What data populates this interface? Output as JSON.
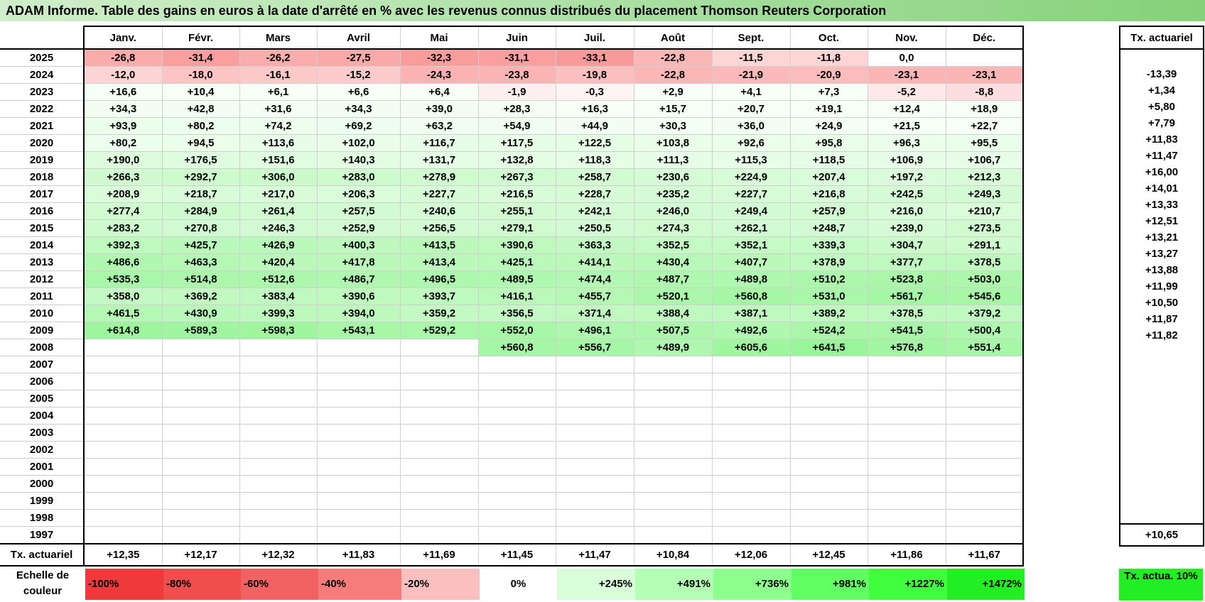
{
  "title": "ADAM Informe. Table des gains en euros à la date d'arrêté en % avec les revenus connus distribués du placement Thomson Reuters Corporation",
  "months": [
    "Janv.",
    "Févr.",
    "Mars",
    "Avril",
    "Mai",
    "Juin",
    "Juil.",
    "Août",
    "Sept.",
    "Oct.",
    "Nov.",
    "Déc."
  ],
  "rate_header": "Tx. actuariel",
  "footer_label": "Tx. actuariel",
  "rows": [
    {
      "year": "2025",
      "cells": [
        "-26,8",
        "-31,4",
        "-26,2",
        "-27,5",
        "-32,3",
        "-31,1",
        "-33,1",
        "-22,8",
        "-11,5",
        "-11,8",
        "0,0",
        ""
      ],
      "rate": ""
    },
    {
      "year": "2024",
      "cells": [
        "-12,0",
        "-18,0",
        "-16,1",
        "-15,2",
        "-24,3",
        "-23,8",
        "-19,8",
        "-22,8",
        "-21,9",
        "-20,9",
        "-23,1",
        "-23,1"
      ],
      "rate": "-13,39"
    },
    {
      "year": "2023",
      "cells": [
        "+16,6",
        "+10,4",
        "+6,1",
        "+6,6",
        "+6,4",
        "-1,9",
        "-0,3",
        "+2,9",
        "+4,1",
        "+7,3",
        "-5,2",
        "-8,8"
      ],
      "rate": "+1,34"
    },
    {
      "year": "2022",
      "cells": [
        "+34,3",
        "+42,8",
        "+31,6",
        "+34,3",
        "+39,0",
        "+28,3",
        "+16,3",
        "+15,7",
        "+20,7",
        "+19,1",
        "+12,4",
        "+18,9"
      ],
      "rate": "+5,80"
    },
    {
      "year": "2021",
      "cells": [
        "+93,9",
        "+80,2",
        "+74,2",
        "+69,2",
        "+63,2",
        "+54,9",
        "+44,9",
        "+30,3",
        "+36,0",
        "+24,9",
        "+21,5",
        "+22,7"
      ],
      "rate": "+7,79"
    },
    {
      "year": "2020",
      "cells": [
        "+80,2",
        "+94,5",
        "+113,6",
        "+102,0",
        "+116,7",
        "+117,5",
        "+122,5",
        "+103,8",
        "+92,6",
        "+95,8",
        "+96,3",
        "+95,5"
      ],
      "rate": "+11,83"
    },
    {
      "year": "2019",
      "cells": [
        "+190,0",
        "+176,5",
        "+151,6",
        "+140,3",
        "+131,7",
        "+132,8",
        "+118,3",
        "+111,3",
        "+115,3",
        "+118,5",
        "+106,9",
        "+106,7"
      ],
      "rate": "+11,47"
    },
    {
      "year": "2018",
      "cells": [
        "+266,3",
        "+292,7",
        "+306,0",
        "+283,0",
        "+278,9",
        "+267,3",
        "+258,7",
        "+230,6",
        "+224,9",
        "+207,4",
        "+197,2",
        "+212,3"
      ],
      "rate": "+16,00"
    },
    {
      "year": "2017",
      "cells": [
        "+208,9",
        "+218,7",
        "+217,0",
        "+206,3",
        "+227,7",
        "+216,5",
        "+228,7",
        "+235,2",
        "+227,7",
        "+216,8",
        "+242,5",
        "+249,3"
      ],
      "rate": "+14,01"
    },
    {
      "year": "2016",
      "cells": [
        "+277,4",
        "+284,9",
        "+261,4",
        "+257,5",
        "+240,6",
        "+255,1",
        "+242,1",
        "+246,0",
        "+249,4",
        "+257,9",
        "+216,0",
        "+210,7"
      ],
      "rate": "+13,33"
    },
    {
      "year": "2015",
      "cells": [
        "+283,2",
        "+270,8",
        "+246,3",
        "+252,9",
        "+256,5",
        "+279,1",
        "+250,5",
        "+274,3",
        "+262,1",
        "+248,7",
        "+239,0",
        "+273,5"
      ],
      "rate": "+12,51"
    },
    {
      "year": "2014",
      "cells": [
        "+392,3",
        "+425,7",
        "+426,9",
        "+400,3",
        "+413,5",
        "+390,6",
        "+363,3",
        "+352,5",
        "+352,1",
        "+339,3",
        "+304,7",
        "+291,1"
      ],
      "rate": "+13,21"
    },
    {
      "year": "2013",
      "cells": [
        "+486,6",
        "+463,3",
        "+420,4",
        "+417,8",
        "+413,4",
        "+425,1",
        "+414,1",
        "+430,4",
        "+407,7",
        "+378,9",
        "+377,7",
        "+378,5"
      ],
      "rate": "+13,27"
    },
    {
      "year": "2012",
      "cells": [
        "+535,3",
        "+514,8",
        "+512,6",
        "+486,7",
        "+496,5",
        "+489,5",
        "+474,4",
        "+487,7",
        "+489,8",
        "+510,2",
        "+523,8",
        "+503,0"
      ],
      "rate": "+13,88"
    },
    {
      "year": "2011",
      "cells": [
        "+358,0",
        "+369,2",
        "+383,4",
        "+390,6",
        "+393,7",
        "+416,1",
        "+455,7",
        "+520,1",
        "+560,8",
        "+531,0",
        "+561,7",
        "+545,6"
      ],
      "rate": "+11,99"
    },
    {
      "year": "2010",
      "cells": [
        "+461,5",
        "+430,9",
        "+399,3",
        "+394,0",
        "+359,2",
        "+356,5",
        "+371,4",
        "+388,4",
        "+387,1",
        "+389,2",
        "+378,5",
        "+379,2"
      ],
      "rate": "+10,50"
    },
    {
      "year": "2009",
      "cells": [
        "+614,8",
        "+589,3",
        "+598,3",
        "+543,1",
        "+529,2",
        "+552,0",
        "+496,1",
        "+507,5",
        "+492,6",
        "+524,2",
        "+541,5",
        "+500,4"
      ],
      "rate": "+11,87"
    },
    {
      "year": "2008",
      "cells": [
        "",
        "",
        "",
        "",
        "",
        "+560,8",
        "+556,7",
        "+489,9",
        "+605,6",
        "+641,5",
        "+576,8",
        "+551,4"
      ],
      "rate": "+11,82"
    },
    {
      "year": "2007",
      "cells": [
        "",
        "",
        "",
        "",
        "",
        "",
        "",
        "",
        "",
        "",
        "",
        ""
      ],
      "rate": ""
    },
    {
      "year": "2006",
      "cells": [
        "",
        "",
        "",
        "",
        "",
        "",
        "",
        "",
        "",
        "",
        "",
        ""
      ],
      "rate": ""
    },
    {
      "year": "2005",
      "cells": [
        "",
        "",
        "",
        "",
        "",
        "",
        "",
        "",
        "",
        "",
        "",
        ""
      ],
      "rate": ""
    },
    {
      "year": "2004",
      "cells": [
        "",
        "",
        "",
        "",
        "",
        "",
        "",
        "",
        "",
        "",
        "",
        ""
      ],
      "rate": ""
    },
    {
      "year": "2003",
      "cells": [
        "",
        "",
        "",
        "",
        "",
        "",
        "",
        "",
        "",
        "",
        "",
        ""
      ],
      "rate": ""
    },
    {
      "year": "2002",
      "cells": [
        "",
        "",
        "",
        "",
        "",
        "",
        "",
        "",
        "",
        "",
        "",
        ""
      ],
      "rate": ""
    },
    {
      "year": "2001",
      "cells": [
        "",
        "",
        "",
        "",
        "",
        "",
        "",
        "",
        "",
        "",
        "",
        ""
      ],
      "rate": ""
    },
    {
      "year": "2000",
      "cells": [
        "",
        "",
        "",
        "",
        "",
        "",
        "",
        "",
        "",
        "",
        "",
        ""
      ],
      "rate": ""
    },
    {
      "year": "1999",
      "cells": [
        "",
        "",
        "",
        "",
        "",
        "",
        "",
        "",
        "",
        "",
        "",
        ""
      ],
      "rate": ""
    },
    {
      "year": "1998",
      "cells": [
        "",
        "",
        "",
        "",
        "",
        "",
        "",
        "",
        "",
        "",
        "",
        ""
      ],
      "rate": ""
    },
    {
      "year": "1997",
      "cells": [
        "",
        "",
        "",
        "",
        "",
        "",
        "",
        "",
        "",
        "",
        "",
        ""
      ],
      "rate": ""
    }
  ],
  "footer": {
    "cells": [
      "+12,35",
      "+12,17",
      "+12,32",
      "+11,83",
      "+11,69",
      "+11,45",
      "+11,47",
      "+10,84",
      "+12,06",
      "+12,45",
      "+11,86",
      "+11,67"
    ],
    "rate": "+10,65"
  },
  "scale": {
    "label": "Echelle de couleur",
    "steps": [
      "-100%",
      "-80%",
      "-60%",
      "-40%",
      "-20%",
      "0%",
      "+245%",
      "+491%",
      "+736%",
      "+981%",
      "+1227%",
      "+1472%"
    ],
    "colors": [
      "#ee3a3a",
      "#f04d4d",
      "#f36262",
      "#f67c7c",
      "#fbbfbf",
      "#ffffff",
      "#d8ffd8",
      "#b3ffb3",
      "#8cff8c",
      "#62ff62",
      "#3fff3f",
      "#22ee22"
    ],
    "legend": "Tx. actua. 10%",
    "legend_color": "#22ee22"
  }
}
